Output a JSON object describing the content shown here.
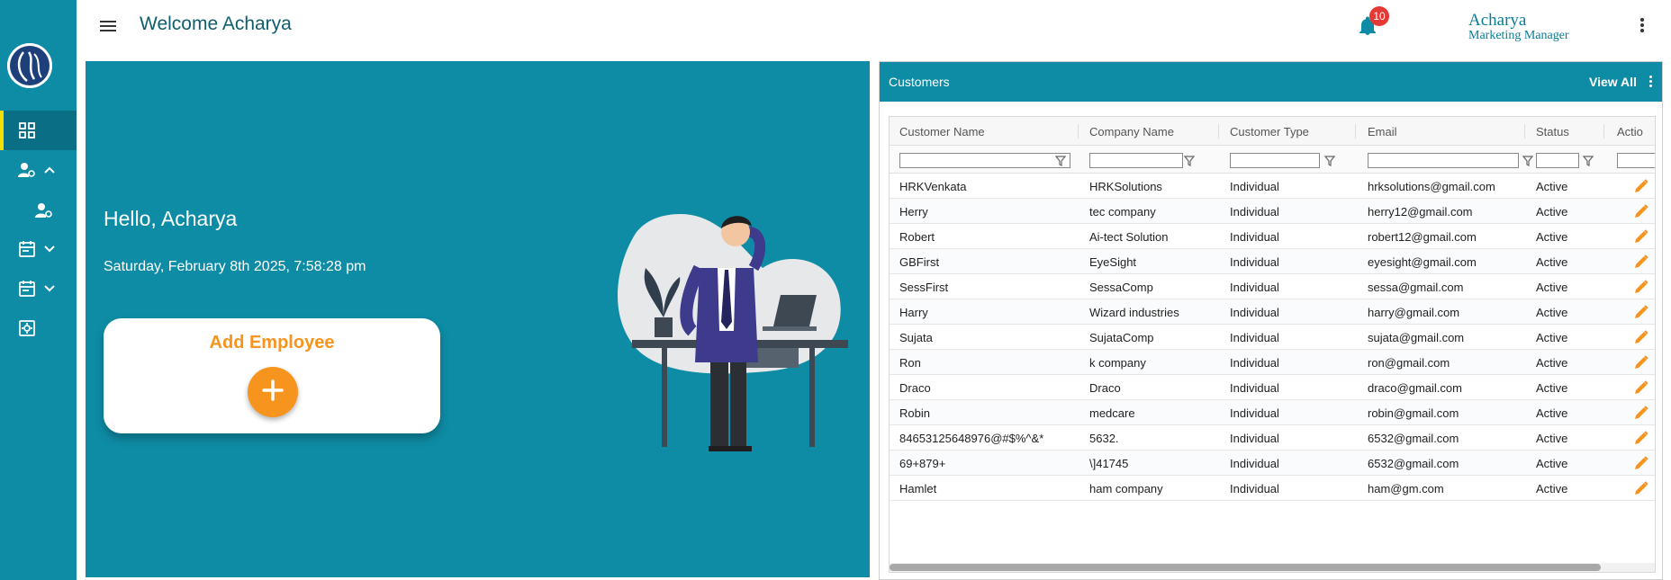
{
  "header": {
    "welcome": "Welcome Acharya",
    "notification_count": "10",
    "user_name": "Acharya",
    "user_role": "Marketing Manager"
  },
  "sidebar": {
    "items": [
      {
        "icon": "dashboard-icon",
        "active": true
      },
      {
        "icon": "user-settings-icon",
        "expanded": true
      },
      {
        "icon": "user-settings-icon",
        "sub": true
      },
      {
        "icon": "calendar-icon",
        "expanded": false
      },
      {
        "icon": "calendar-icon",
        "expanded": false
      },
      {
        "icon": "settings-box-icon"
      }
    ]
  },
  "hero": {
    "greeting": "Hello, Acharya",
    "datetime": "Saturday, February 8th 2025, 7:58:28 pm",
    "add_employee_label": "Add Employee"
  },
  "customers": {
    "title": "Customers",
    "view_all": "View All",
    "columns": [
      "Customer Name",
      "Company Name",
      "Customer Type",
      "Email",
      "Status",
      "Actio"
    ],
    "rows": [
      [
        "HRKVenkata",
        "HRKSolutions",
        "Individual",
        "hrksolutions@gmail.com",
        "Active"
      ],
      [
        "Herry",
        "tec company",
        "Individual",
        "herry12@gmail.com",
        "Active"
      ],
      [
        "Robert",
        "Ai-tect Solution",
        "Individual",
        "robert12@gmail.com",
        "Active"
      ],
      [
        "GBFirst",
        "EyeSight",
        "Individual",
        "eyesight@gmail.com",
        "Active"
      ],
      [
        "SessFirst",
        "SessaComp",
        "Individual",
        "sessa@gmail.com",
        "Active"
      ],
      [
        "Harry",
        "Wizard industries",
        "Individual",
        "harry@gmail.com",
        "Active"
      ],
      [
        "Sujata",
        "SujataComp",
        "Individual",
        "sujata@gmail.com",
        "Active"
      ],
      [
        "Ron",
        "k company",
        "Individual",
        "ron@gmail.com",
        "Active"
      ],
      [
        "Draco",
        "Draco",
        "Individual",
        "draco@gmail.com",
        "Active"
      ],
      [
        "Robin",
        "medcare",
        "Individual",
        "robin@gmail.com",
        "Active"
      ],
      [
        "84653125648976@#$%^&*",
        "5632.",
        "Individual",
        "6532@gmail.com",
        "Active"
      ],
      [
        "69+879+",
        "\\]41745",
        "Individual",
        "6532@gmail.com",
        "Active"
      ],
      [
        "Hamlet",
        "ham company",
        "Individual",
        "ham@gm.com",
        "Active"
      ]
    ]
  },
  "colors": {
    "teal": "#0e8ca5",
    "orange": "#f7941d",
    "badge_red": "#e53935",
    "active_bar": "#f5e100"
  }
}
